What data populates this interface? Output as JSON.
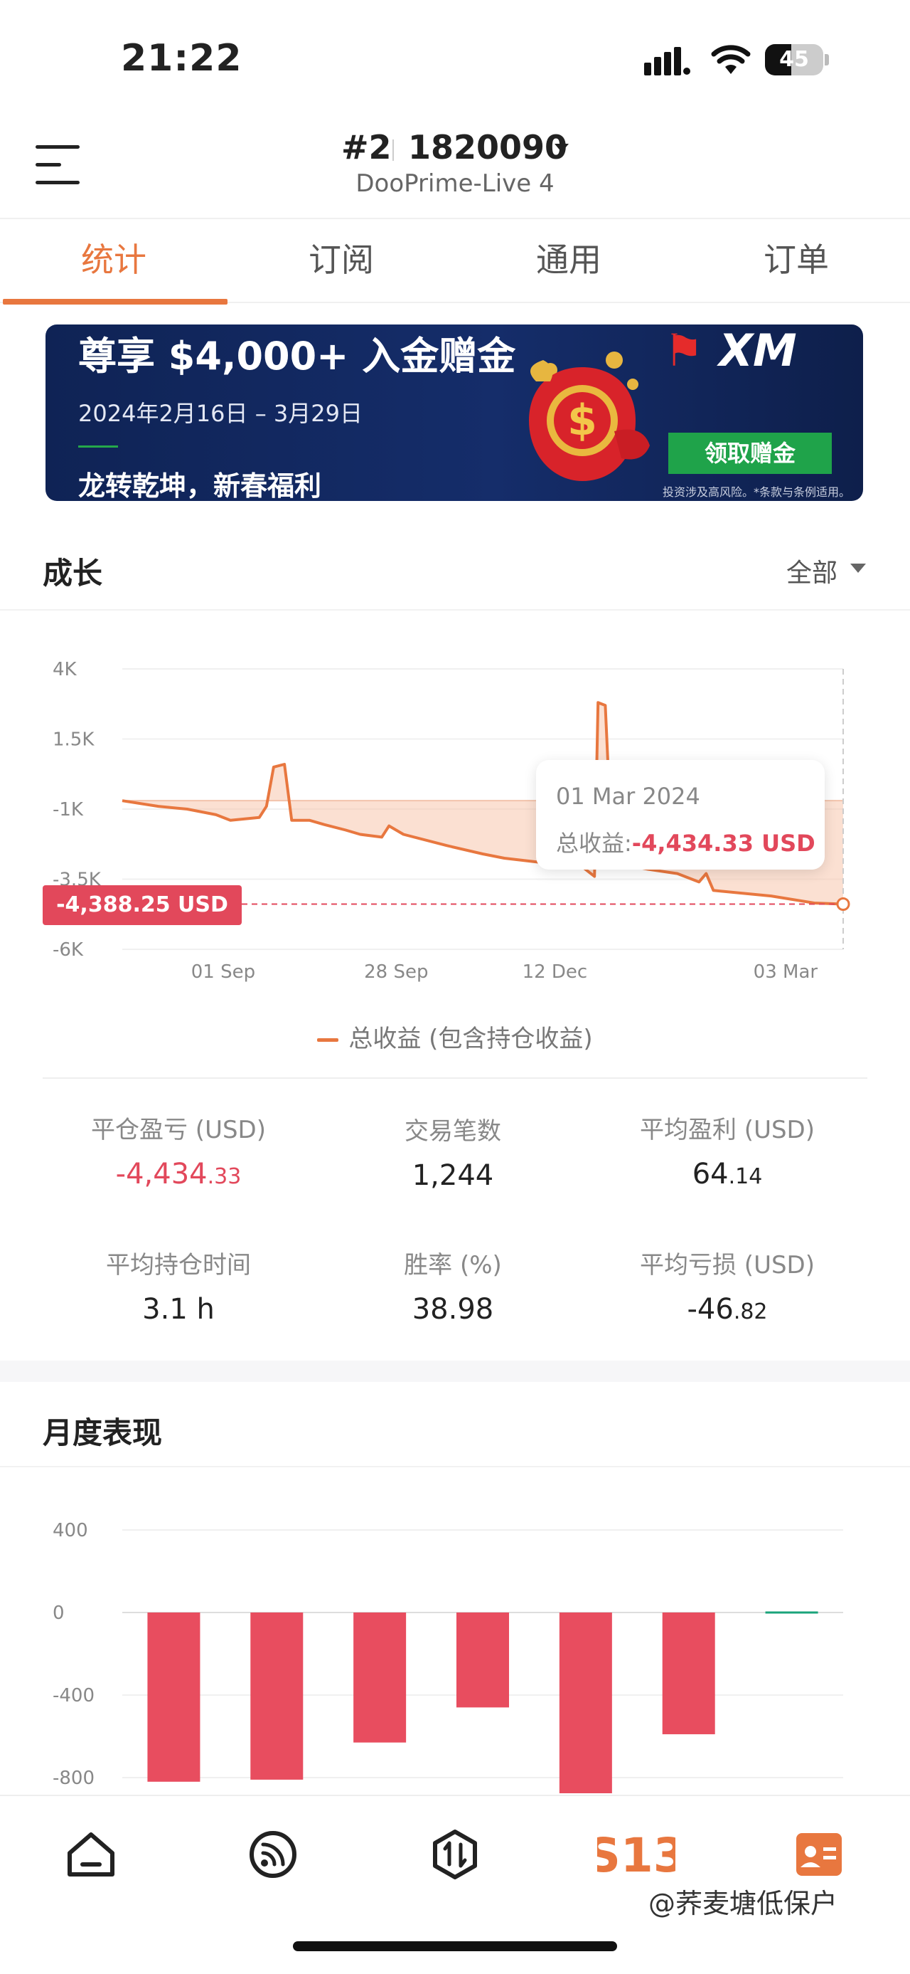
{
  "status_bar": {
    "time": "21:22",
    "battery": "45",
    "battery_level": 0.45
  },
  "header": {
    "account_no": "#2",
    "account_id": "1820090",
    "server": "DooPrime-Live 4"
  },
  "tabs": [
    {
      "label": "统计",
      "active": true
    },
    {
      "label": "订阅",
      "active": false
    },
    {
      "label": "通用",
      "active": false
    },
    {
      "label": "订单",
      "active": false
    }
  ],
  "banner": {
    "title": "尊享 $4,000+ 入金赠金",
    "dates": "2024年2月16日 – 3月29日",
    "slogan": "龙转乾坤，新春福利",
    "brand": "XM",
    "cta": "领取赠金",
    "disclaimer": "投资涉及高风险。*条款与条例适用。"
  },
  "growth": {
    "title": "成长",
    "range": "全部",
    "tooltip_date": "01 Mar 2024",
    "tooltip_label": "总收益:",
    "tooltip_value": "-4,434.33 USD",
    "current_value": "-4,388.25 USD",
    "legend": "总收益 (包含持仓收益)",
    "accent": "#e8773f",
    "negative_color": "#e2485b"
  },
  "stats": {
    "closed_pl": {
      "label": "平仓盈亏 (USD)",
      "int": "-4,434",
      "dec": ".33"
    },
    "trades": {
      "label": "交易笔数",
      "value": "1,244"
    },
    "avg_profit": {
      "label": "平均盈利 (USD)",
      "int": "64",
      "dec": ".14"
    },
    "avg_hold": {
      "label": "平均持仓时间",
      "value": "3.1 h"
    },
    "win_rate": {
      "label": "胜率 (%)",
      "value": "38.98"
    },
    "avg_loss": {
      "label": "平均亏损 (USD)",
      "int": "-46",
      "dec": ".82"
    }
  },
  "monthly": {
    "title": "月度表现"
  },
  "watermark": "@荞麦塘低保户",
  "chart_data": [
    {
      "type": "area",
      "y_ticks": [
        "4K",
        "1.5K",
        "-1K",
        "-3.5K",
        "-6K"
      ],
      "ylim": [
        -6000,
        4000
      ],
      "x_ticks": [
        "01 Sep",
        "28 Sep",
        "12 Dec",
        "03 Mar"
      ],
      "series": [
        {
          "name": "总收益 (包含持仓收益)",
          "points": [
            [
              0,
              -700
            ],
            [
              0.05,
              -900
            ],
            [
              0.09,
              -1000
            ],
            [
              0.13,
              -1200
            ],
            [
              0.15,
              -1400
            ],
            [
              0.17,
              -1350
            ],
            [
              0.19,
              -1300
            ],
            [
              0.2,
              -900
            ],
            [
              0.21,
              500
            ],
            [
              0.225,
              600
            ],
            [
              0.235,
              -1400
            ],
            [
              0.26,
              -1400
            ],
            [
              0.28,
              -1550
            ],
            [
              0.31,
              -1750
            ],
            [
              0.33,
              -1900
            ],
            [
              0.36,
              -2000
            ],
            [
              0.37,
              -1600
            ],
            [
              0.39,
              -1900
            ],
            [
              0.45,
              -2300
            ],
            [
              0.5,
              -2600
            ],
            [
              0.53,
              -2750
            ],
            [
              0.58,
              -2900
            ],
            [
              0.61,
              -3050
            ],
            [
              0.64,
              -3100
            ],
            [
              0.655,
              -3400
            ],
            [
              0.66,
              2800
            ],
            [
              0.67,
              2700
            ],
            [
              0.68,
              -2900
            ],
            [
              0.73,
              -3150
            ],
            [
              0.77,
              -3300
            ],
            [
              0.8,
              -3600
            ],
            [
              0.81,
              -3300
            ],
            [
              0.82,
              -3900
            ],
            [
              0.9,
              -4100
            ],
            [
              0.96,
              -4350
            ],
            [
              1,
              -4388.25
            ]
          ]
        }
      ]
    },
    {
      "type": "bar",
      "y_ticks": [
        "400",
        "0",
        "-400",
        "-800"
      ],
      "ylim": [
        -800,
        400
      ],
      "values": [
        -820,
        -810,
        -630,
        -460,
        -880,
        -590,
        0
      ]
    }
  ]
}
